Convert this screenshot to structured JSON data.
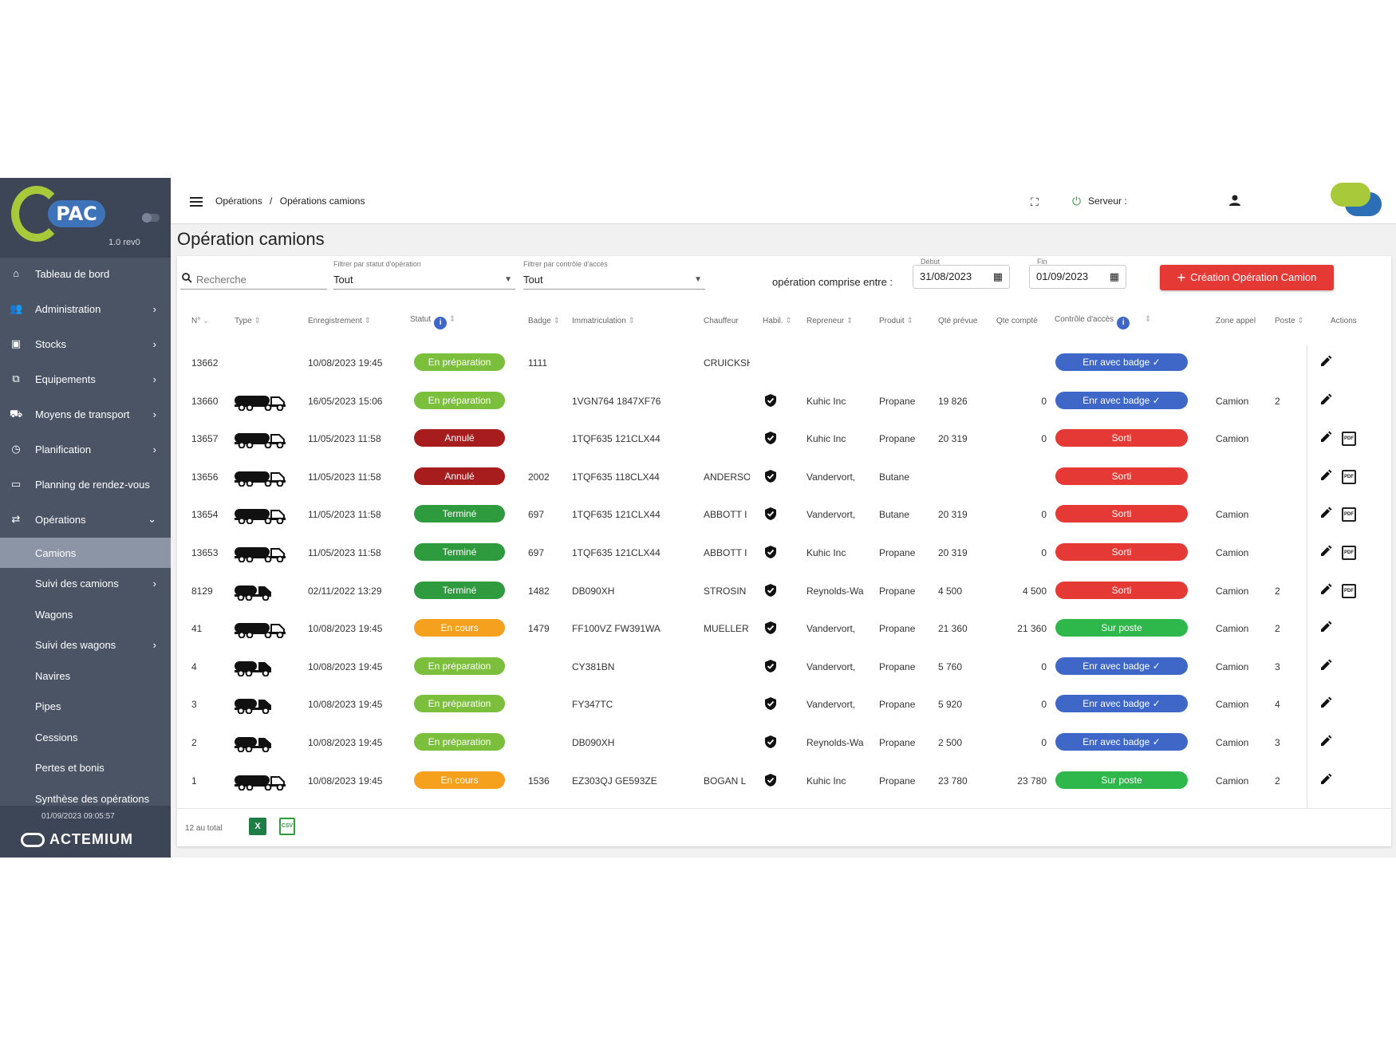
{
  "app": {
    "version": "1.0 rev0",
    "logo_g": "G",
    "logo_pac": "PAC"
  },
  "sidebar": {
    "items": [
      {
        "label": "Tableau de bord",
        "icon": "home-icon",
        "chevron": ""
      },
      {
        "label": "Administration",
        "icon": "users-icon",
        "chevron": "›"
      },
      {
        "label": "Stocks",
        "icon": "archive-icon",
        "chevron": "›"
      },
      {
        "label": "Equipements",
        "icon": "network-icon",
        "chevron": "›"
      },
      {
        "label": "Moyens de transport",
        "icon": "truck-icon",
        "chevron": "›"
      },
      {
        "label": "Planification",
        "icon": "clock-icon",
        "chevron": "›"
      },
      {
        "label": "Planning de rendez-vous",
        "icon": "calendar-icon",
        "chevron": ""
      },
      {
        "label": "Opérations",
        "icon": "swap-icon",
        "chevron": "⌄"
      }
    ],
    "subitems": [
      {
        "label": "Camions",
        "chevron": ""
      },
      {
        "label": "Suivi des camions",
        "chevron": "›"
      },
      {
        "label": "Wagons",
        "chevron": ""
      },
      {
        "label": "Suivi des wagons",
        "chevron": "›"
      },
      {
        "label": "Navires",
        "chevron": ""
      },
      {
        "label": "Pipes",
        "chevron": ""
      },
      {
        "label": "Cessions",
        "chevron": ""
      },
      {
        "label": "Pertes et bonis",
        "chevron": ""
      },
      {
        "label": "Synthèse des opérations",
        "chevron": ""
      }
    ],
    "datetime": "01/09/2023 09:05:57",
    "brand": "ACTEMIUM"
  },
  "topbar": {
    "breadcrumb": [
      "Opérations",
      "/",
      "Opérations camions"
    ],
    "server_label": "Serveur :"
  },
  "page": {
    "title": "Opération camions"
  },
  "filters": {
    "search_placeholder": "Recherche",
    "status_label": "Filtrer par statut d'opération",
    "status_value": "Tout",
    "access_label": "Filtrer par contrôle d'accès",
    "access_value": "Tout",
    "between_label": "opération comprise entre :",
    "start_label": "Début",
    "start_value": "31/08/2023",
    "end_label": "Fin",
    "end_value": "01/09/2023",
    "create_button": "Création Opération Camion"
  },
  "table": {
    "headers": {
      "num": "N°",
      "type": "Type",
      "registration": "Enregistrement",
      "status": "Statut",
      "badge": "Badge",
      "plate": "Immatriculation",
      "driver": "Chauffeur",
      "habil": "Habil.",
      "carrier": "Repreneur",
      "product": "Produit",
      "planned": "Qté prévue",
      "counted": "Qte compté",
      "access": "Contrôle d'accès",
      "zone": "Zone appel",
      "post": "Poste",
      "actions": "Actions"
    },
    "rows": [
      {
        "num": "13662",
        "truck": "",
        "date": "10/08/2023 19:45",
        "status": "En préparation",
        "badge": "1111",
        "plate": "",
        "driver": "CRUICKSH",
        "habil": false,
        "carrier": "",
        "product": "",
        "planned": "",
        "counted": "",
        "access": "Enr avec badge ✓",
        "zone": "",
        "post": "",
        "pdf": false
      },
      {
        "num": "13660",
        "truck": "semi",
        "date": "16/05/2023 15:06",
        "status": "En préparation",
        "badge": "",
        "plate": "1VGN764 1847XF76",
        "driver": "",
        "habil": true,
        "carrier": "Kuhic Inc",
        "product": "Propane",
        "planned": "19 826",
        "counted": "0",
        "access": "Enr avec badge ✓",
        "zone": "Camion",
        "post": "2",
        "pdf": false
      },
      {
        "num": "13657",
        "truck": "semi",
        "date": "11/05/2023 11:58",
        "status": "Annulé",
        "badge": "",
        "plate": "1TQF635 121CLX44",
        "driver": "",
        "habil": true,
        "carrier": "Kuhic Inc",
        "product": "Propane",
        "planned": "20 319",
        "counted": "0",
        "access": "Sorti",
        "zone": "Camion",
        "post": "",
        "pdf": true
      },
      {
        "num": "13656",
        "truck": "semi",
        "date": "11/05/2023 11:58",
        "status": "Annulé",
        "badge": "2002",
        "plate": "1TQF635 118CLX44",
        "driver": "ANDERSO",
        "habil": true,
        "carrier": "Vandervort, ",
        "product": "Butane",
        "planned": "",
        "counted": "",
        "access": "Sorti",
        "zone": "",
        "post": "",
        "pdf": true
      },
      {
        "num": "13654",
        "truck": "semi",
        "date": "11/05/2023 11:58",
        "status": "Terminé",
        "badge": "697",
        "plate": "1TQF635 121CLX44",
        "driver": "ABBOTT I",
        "habil": true,
        "carrier": "Vandervort, ",
        "product": "Butane",
        "planned": "20 319",
        "counted": "0",
        "access": "Sorti",
        "zone": "Camion",
        "post": "",
        "pdf": true
      },
      {
        "num": "13653",
        "truck": "semi",
        "date": "11/05/2023 11:58",
        "status": "Terminé",
        "badge": "697",
        "plate": "1TQF635 121CLX44",
        "driver": "ABBOTT I",
        "habil": true,
        "carrier": "Kuhic Inc",
        "product": "Propane",
        "planned": "20 319",
        "counted": "0",
        "access": "Sorti",
        "zone": "Camion",
        "post": "",
        "pdf": true
      },
      {
        "num": "8129",
        "truck": "rigid",
        "date": "02/11/2022 13:29",
        "status": "Terminé",
        "badge": "1482",
        "plate": "DB090XH",
        "driver": "STROSIN",
        "habil": true,
        "carrier": "Reynolds-Wa",
        "product": "Propane",
        "planned": "4 500",
        "counted": "4 500",
        "access": "Sorti",
        "zone": "Camion",
        "post": "2",
        "pdf": true
      },
      {
        "num": "41",
        "truck": "semi",
        "date": "10/08/2023 19:45",
        "status": "En cours",
        "badge": "1479",
        "plate": "FF100VZ FW391WA",
        "driver": "MUELLER",
        "habil": true,
        "carrier": "Vandervort, ",
        "product": "Propane",
        "planned": "21 360",
        "counted": "21 360",
        "access": "Sur poste",
        "zone": "Camion",
        "post": "2",
        "pdf": false
      },
      {
        "num": "4",
        "truck": "rigid",
        "date": "10/08/2023 19:45",
        "status": "En préparation",
        "badge": "",
        "plate": "CY381BN",
        "driver": "",
        "habil": true,
        "carrier": "Vandervort, ",
        "product": "Propane",
        "planned": "5 760",
        "counted": "0",
        "access": "Enr avec badge ✓",
        "zone": "Camion",
        "post": "3",
        "pdf": false
      },
      {
        "num": "3",
        "truck": "rigid",
        "date": "10/08/2023 19:45",
        "status": "En préparation",
        "badge": "",
        "plate": "FY347TC",
        "driver": "",
        "habil": true,
        "carrier": "Vandervort, ",
        "product": "Propane",
        "planned": "5 920",
        "counted": "0",
        "access": "Enr avec badge ✓",
        "zone": "Camion",
        "post": "4",
        "pdf": false
      },
      {
        "num": "2",
        "truck": "rigid",
        "date": "10/08/2023 19:45",
        "status": "En préparation",
        "badge": "",
        "plate": "DB090XH",
        "driver": "",
        "habil": true,
        "carrier": "Reynolds-Wa",
        "product": "Propane",
        "planned": "2 500",
        "counted": "0",
        "access": "Enr avec badge ✓",
        "zone": "Camion",
        "post": "3",
        "pdf": false
      },
      {
        "num": "1",
        "truck": "semi",
        "date": "10/08/2023 19:45",
        "status": "En cours",
        "badge": "1536",
        "plate": "EZ303QJ GE593ZE",
        "driver": "BOGAN L",
        "habil": true,
        "carrier": "Kuhic Inc",
        "product": "Propane",
        "planned": "23 780",
        "counted": "23 780",
        "access": "Sur poste",
        "zone": "Camion",
        "post": "2",
        "pdf": false
      }
    ],
    "total_label": "12 au total",
    "export_excel": "X",
    "export_csv": "CSV",
    "pdf_label": "PDF"
  },
  "colors": {
    "sidebar_bg": "#4a5465",
    "sidebar_active": "#8c95a5",
    "status_preparation": "#7cbf3c",
    "status_annule": "#a71d1d",
    "status_termine": "#2e9b3e",
    "status_encours": "#f5a11d",
    "access_badge": "#3e67c7",
    "access_sorti": "#e53935",
    "access_surposte": "#2eb84c",
    "accent_red": "#e53935"
  }
}
